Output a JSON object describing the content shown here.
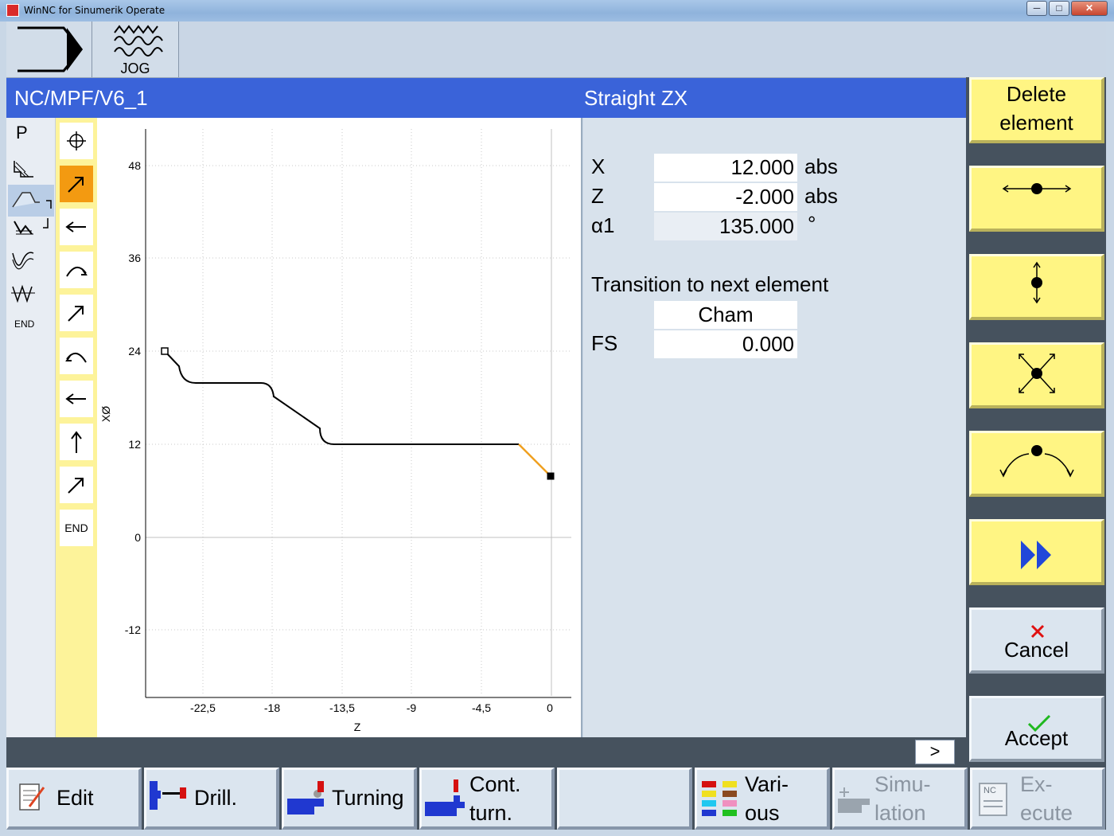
{
  "window": {
    "title": "WinNC for Sinumerik Operate",
    "buttons": [
      "─",
      "□",
      "✕"
    ]
  },
  "topbar": {
    "jog_label": "JOG"
  },
  "header": {
    "program_path": "NC/MPF/V6_1",
    "mode_title": "Straight ZX"
  },
  "left_strip": {
    "items": [
      "P",
      "END"
    ]
  },
  "element_list": {
    "items": [
      "pole-icon",
      "straight-diagonal-icon",
      "straight-left-icon",
      "arc-cw-icon",
      "straight-diagonal-icon",
      "arc-ccw-icon",
      "straight-left-icon",
      "straight-up-icon",
      "straight-diagonal-icon",
      "END"
    ],
    "active_index": 1,
    "end_label": "END"
  },
  "graph": {
    "x_axis_label": "Z",
    "y_axis_label": "XØ",
    "x_ticks": [
      "-22,5",
      "-18",
      "-13,5",
      "-9",
      "-4,5",
      "0"
    ],
    "y_ticks": [
      "48",
      "36",
      "24",
      "12",
      "0",
      "-12"
    ]
  },
  "params": {
    "x_label": "X",
    "x_value": "12.000",
    "x_unit": "abs",
    "z_label": "Z",
    "z_value": "-2.000",
    "z_unit": "abs",
    "a1_label": "α1",
    "a1_value": "135.000",
    "a1_unit": "°",
    "transition_label": "Transition to next element",
    "transition_value": "Cham",
    "fs_label": "FS",
    "fs_value": "0.000"
  },
  "vertical_softkeys": {
    "delete_element": "Delete element",
    "delete_line1": "Delete",
    "delete_line2": "element",
    "cancel": "Cancel",
    "accept": "Accept"
  },
  "status": {
    "more_button": ">"
  },
  "horizontal_softkeys": {
    "edit": "Edit",
    "drill": "Drill.",
    "turning": "Turning",
    "cont_turn_1": "Cont.",
    "cont_turn_2": "turn.",
    "various_1": "Vari-",
    "various_2": "ous",
    "simulation_1": "Simu-",
    "simulation_2": "lation",
    "execute_1": "Ex-",
    "execute_2": "ecute",
    "nc_badge": "NC"
  },
  "colors": {
    "header_blue": "#3a63d9",
    "softkey_yellow": "#fff583",
    "active_element": "#f39a11",
    "contour_highlight": "#f0a020"
  }
}
